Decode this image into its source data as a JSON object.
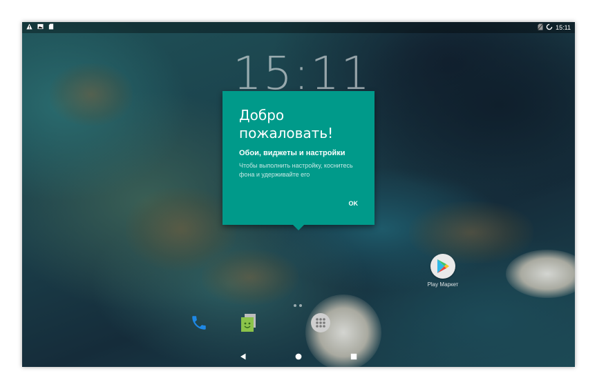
{
  "status_bar": {
    "time": "15:11",
    "left_icons": [
      "warning-icon",
      "image-icon",
      "sd-card-icon"
    ],
    "right_icons": [
      "no-sim-icon",
      "loading-icon"
    ]
  },
  "lockscreen_clock": "15:11",
  "welcome_dialog": {
    "title": "Добро пожаловать!",
    "subtitle": "Обои, виджеты и настройки",
    "body": "Чтобы выполнить настройку, коснитесь фона и удерживайте его",
    "ok_label": "OK",
    "background_color": "#009a8a"
  },
  "desktop_apps": [
    {
      "label": "Play Маркет",
      "icon": "play-store-icon"
    }
  ],
  "dock": {
    "items": [
      "phone-icon",
      "messaging-icon",
      "all-apps-icon"
    ]
  },
  "nav_bar": {
    "buttons": [
      "back-icon",
      "home-icon",
      "recents-icon"
    ]
  }
}
